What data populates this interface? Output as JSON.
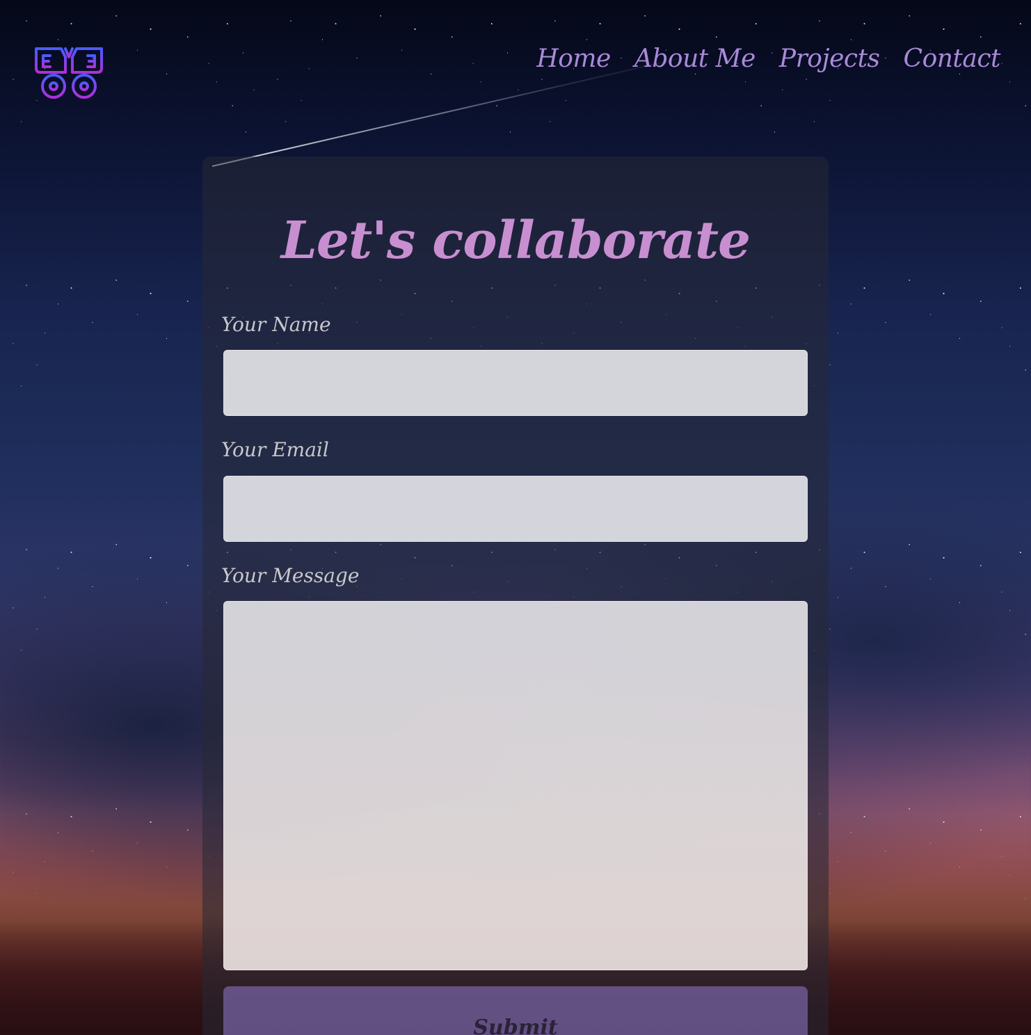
{
  "nav": {
    "items": [
      {
        "label": "Home"
      },
      {
        "label": "About Me"
      },
      {
        "label": "Projects"
      },
      {
        "label": "Contact"
      }
    ]
  },
  "brand": {
    "logo_icon": "butterfly-icon",
    "gradient_start": "#4a5cff",
    "gradient_end": "#b02fd9"
  },
  "form": {
    "title": "Let's collaborate",
    "name_label": "Your Name",
    "name_value": "",
    "email_label": "Your Email",
    "email_value": "",
    "message_label": "Your Message",
    "message_value": "",
    "submit_label": "Submit"
  },
  "colors": {
    "nav_text": "#a98ad8",
    "title_text": "#c88fd0",
    "submit_bg": "#8670bc"
  }
}
